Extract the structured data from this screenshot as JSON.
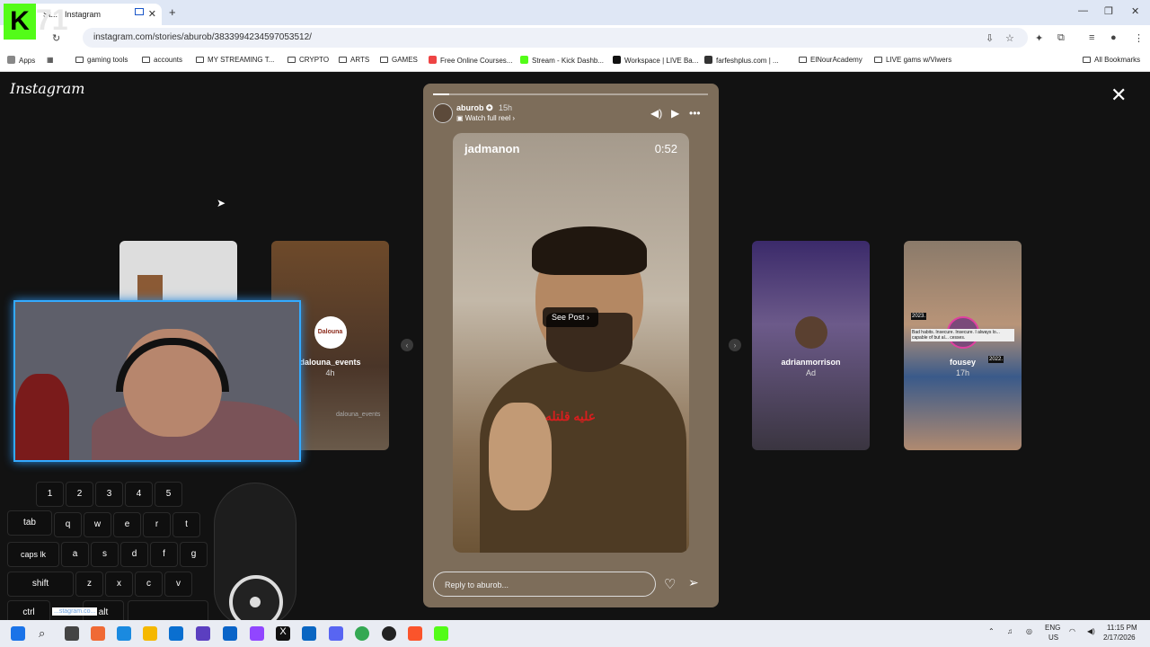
{
  "browser": {
    "tab_title": "St... - Instagram",
    "url": "instagram.com/stories/aburob/3833994234597053512/",
    "bookmarks": [
      "Apps",
      "gaming tools",
      "accounts",
      "MY STREAMING T...",
      "CRYPTO",
      "ARTS",
      "GAMES",
      "Free Online Courses...",
      "Stream - Kick Dashb...",
      "Workspace | LIVE Ba...",
      "farfeshplus.com | ...",
      "ElNourAcademy",
      "LIVE gams w/Viwers",
      "All Bookmarks"
    ]
  },
  "instagram": {
    "logo": "Instagram",
    "story": {
      "username": "aburob",
      "time": "15h",
      "watch_full_reel": "Watch full reel",
      "video_user": "jadmanon",
      "video_time": "0:52",
      "see_post": "See Post",
      "caption_ar": "عليه قلتله",
      "reply_placeholder": "Reply to aburob...",
      "progress_fraction": 0.06
    },
    "side_stories": [
      {
        "name": "dalouna_events",
        "sub": "4h",
        "avatar_text": "Dalouna",
        "overlay_text": "dalouna_events"
      },
      {
        "name": "adrianmorrison",
        "sub": "Ad"
      },
      {
        "name": "fousey",
        "sub": "17h",
        "overlay_1": "2023.",
        "overlay_2": "2022.",
        "overlay_3": "Bad habits. Insecure. Insecure. I always lo... capable of but al... cesses."
      }
    ]
  },
  "overlay": {
    "kick_letter": "K",
    "kick_number": "71",
    "keys_row1": [
      "1",
      "2",
      "3",
      "4",
      "5"
    ],
    "keys_row2": [
      "tab",
      "q",
      "w",
      "e",
      "r",
      "t"
    ],
    "keys_row3": [
      "caps lk",
      "a",
      "s",
      "d",
      "f",
      "g"
    ],
    "keys_row4": [
      "shift",
      "z",
      "x",
      "c",
      "v"
    ],
    "keys_row5": [
      "ctrl",
      "alt"
    ],
    "status_url": "...stagram.co..."
  },
  "taskbar": {
    "lang": "ENG",
    "region": "US",
    "time": "11:15 PM",
    "date": "2/17/2026"
  },
  "colors": {
    "kick_green": "#53fc18",
    "webcam_glow": "#33aaff",
    "caption_red": "#d81e1e"
  }
}
